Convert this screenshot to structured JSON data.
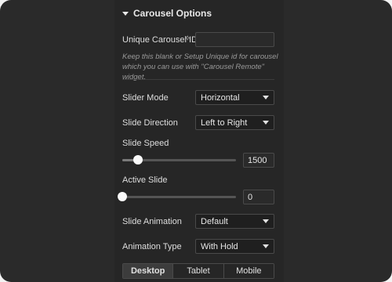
{
  "section": {
    "title": "Carousel Options"
  },
  "unique_id": {
    "label": "Unique Carousel ID",
    "value": "",
    "help": "Keep this blank or Setup Unique id for carousel which you can use with \"Carousel Remote\" widget."
  },
  "slider_mode": {
    "label": "Slider Mode",
    "value": "Horizontal"
  },
  "slide_direction": {
    "label": "Slide Direction",
    "value": "Left to Right"
  },
  "slide_speed": {
    "label": "Slide Speed",
    "value": "1500",
    "fill_fraction": 0.14
  },
  "active_slide": {
    "label": "Active Slide",
    "value": "0",
    "fill_fraction": 0.0
  },
  "slide_animation": {
    "label": "Slide Animation",
    "value": "Default"
  },
  "animation_type": {
    "label": "Animation Type",
    "value": "With Hold"
  },
  "device_tabs": {
    "items": [
      "Desktop",
      "Tablet",
      "Mobile"
    ],
    "active": "Desktop"
  },
  "colors": {
    "panel": "#262626",
    "text": "#e6e6e6",
    "muted": "#9a9a9a",
    "border": "#4a4a4a"
  }
}
